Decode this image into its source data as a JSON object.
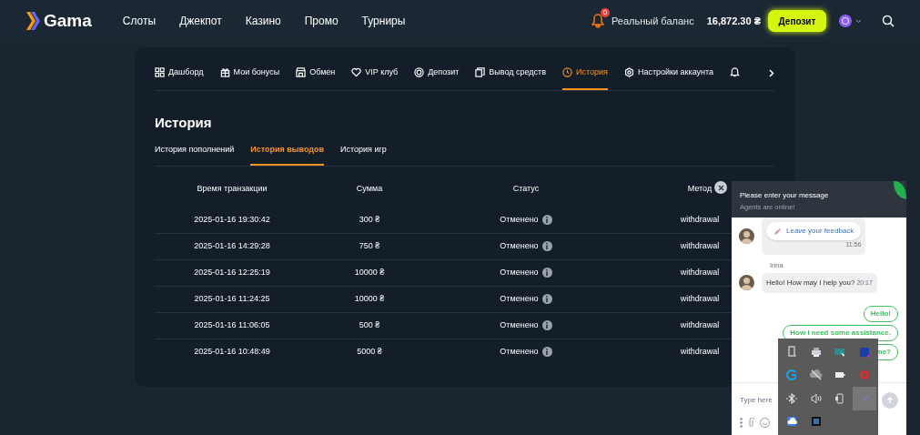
{
  "header": {
    "logo": "Gama",
    "nav": [
      "Слоты",
      "Джекпот",
      "Казино",
      "Промо",
      "Турниры"
    ],
    "notification_count": "0",
    "balance_label": "Реальный баланс",
    "balance": "16,872.30 ₴",
    "deposit_button": "Депозит"
  },
  "account_tabs": [
    {
      "label": "Дашборд",
      "kind": "grid",
      "selected": false
    },
    {
      "label": "Мои бонусы",
      "kind": "gift",
      "selected": false
    },
    {
      "label": "Обмен",
      "kind": "shop",
      "selected": false
    },
    {
      "label": "VIP клуб",
      "kind": "heart",
      "selected": false
    },
    {
      "label": "Депозит",
      "kind": "coin",
      "selected": false
    },
    {
      "label": "Вывод средств",
      "kind": "cards",
      "selected": false
    },
    {
      "label": "История",
      "kind": "clock",
      "selected": true
    },
    {
      "label": "Настройки аккаунта",
      "kind": "gear",
      "selected": false
    },
    {
      "kind": "bell",
      "selected": false
    }
  ],
  "page_title": "История",
  "history_tabs": [
    {
      "label": "История пополнений",
      "selected": false
    },
    {
      "label": "История выводов",
      "selected": true
    },
    {
      "label": "История игр",
      "selected": false
    }
  ],
  "table": {
    "columns": [
      "Время транзакции",
      "Сумма",
      "Статус",
      "Метод"
    ],
    "rows": [
      [
        "2025-01-16 19:30:42",
        "300 ₴",
        "Отменено",
        "withdrawal"
      ],
      [
        "2025-01-16 14:29:28",
        "750 ₴",
        "Отменено",
        "withdrawal"
      ],
      [
        "2025-01-16 12:25:19",
        "10000 ₴",
        "Отменено",
        "withdrawal"
      ],
      [
        "2025-01-16 11:24:25",
        "10000 ₴",
        "Отменено",
        "withdrawal"
      ],
      [
        "2025-01-16 11:06:05",
        "500 ₴",
        "Отменено",
        "withdrawal"
      ],
      [
        "2025-01-16 10:48:49",
        "5000 ₴",
        "Отменено",
        "withdrawal"
      ]
    ]
  },
  "chat": {
    "title": "Please enter your message",
    "subtitle": "Agents are online!",
    "messages": [
      {
        "kind": "agent",
        "button": "Leave your feedback",
        "time": "11:56"
      },
      {
        "kind": "agent",
        "author": "Irina",
        "text": "Hello! How may I help you?",
        "time": "20:17"
      },
      {
        "kind": "quick",
        "text": "Hello!"
      },
      {
        "kind": "quick",
        "text": "How I need some assistance."
      },
      {
        "kind": "quick",
        "text": "me?"
      }
    ],
    "input_placeholder": "Type here"
  },
  "tray": {
    "icons": [
      {
        "kind": "usb",
        "selected": false
      },
      {
        "kind": "printer",
        "selected": false
      },
      {
        "kind": "display",
        "selected": false
      },
      {
        "kind": "app",
        "selected": false
      },
      {
        "kind": "g",
        "selected": false
      },
      {
        "kind": "cloud-off",
        "selected": false
      },
      {
        "kind": "battery",
        "selected": false
      },
      {
        "kind": "target",
        "selected": false
      },
      {
        "kind": "bluetooth",
        "selected": false
      },
      {
        "kind": "speaker",
        "selected": false
      },
      {
        "kind": "phone",
        "selected": false
      },
      {
        "kind": "feather",
        "selected": true
      },
      {
        "kind": "onedrive",
        "selected": false
      },
      {
        "kind": "terminal",
        "selected": false
      }
    ]
  }
}
